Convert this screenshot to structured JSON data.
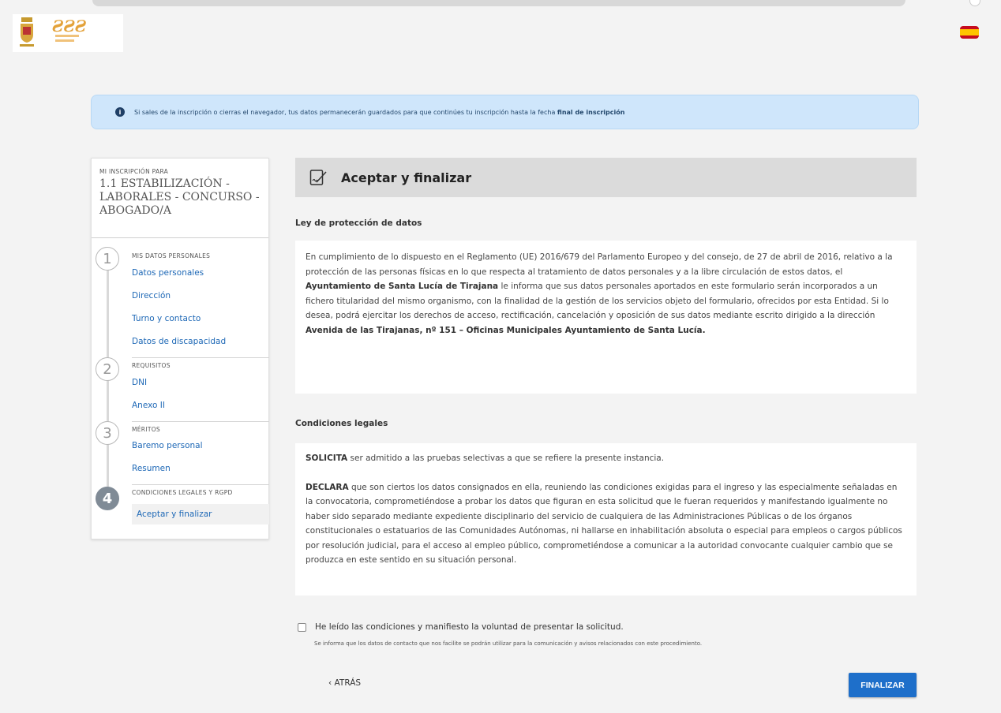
{
  "header": {
    "logo_name": "Santa Lucía",
    "language_flag": "es-flag"
  },
  "notice": {
    "text_before": "Si sales de la inscripción o cierras el navegador, tus datos permanecerán guardados para que continúes tu inscripción hasta la fecha",
    "text_bold": "final de inscripción"
  },
  "sidebar": {
    "caption": "MI INSCRIPCIÓN PARA",
    "title": "1.1 ESTABILIZACIÓN - LABORALES - CONCURSO - ABOGADO/A",
    "sections": [
      {
        "number": "1",
        "title": "MIS DATOS PERSONALES",
        "items": [
          "Datos personales",
          "Dirección",
          "Turno y contacto",
          "Datos de discapacidad"
        ]
      },
      {
        "number": "2",
        "title": "REQUISITOS",
        "items": [
          "DNI",
          "Anexo II"
        ]
      },
      {
        "number": "3",
        "title": "MÉRITOS",
        "items": [
          "Baremo personal",
          "Resumen"
        ]
      },
      {
        "number": "4",
        "title": "CONDICIONES LEGALES Y RGPD",
        "items": [
          "Aceptar y finalizar"
        ]
      }
    ]
  },
  "main": {
    "title": "Aceptar y finalizar",
    "section1_title": "Ley de protección de datos",
    "section1_p1_a": "En cumplimiento de lo dispuesto en el Reglamento (UE) 2016/679 del Parlamento Europeo y del consejo, de 27 de abril de 2016, relativo a la protección de las personas físicas en lo que respecta al tratamiento de datos personales y a la libre circulación de estos datos, el ",
    "section1_p1_b": "Ayuntamiento de Santa Lucía de Tirajana",
    "section1_p1_c": " le informa que sus datos personales aportados en este formulario serán incorporados a un fichero titularidad del mismo organismo, con la finalidad de la gestión de los servicios objeto del formulario, ofrecidos por esta Entidad. Si lo desea, podrá ejercitar los derechos de acceso, rectificación, cancelación y oposición de sus datos mediante escrito dirigido a la dirección ",
    "section1_p1_d": "Avenida de las Tirajanas, nº 151 – Oficinas Municipales Ayuntamiento de Santa Lucía.",
    "section2_title": "Condiciones legales",
    "solicita_b": "SOLICITA",
    "solicita_t": " ser admitido a las pruebas selectivas a que se refiere la presente instancia.",
    "declara_b": "DECLARA",
    "declara_t": " que son ciertos los datos consignados en ella, reuniendo las condiciones exigidas para el ingreso y las especialmente señaladas en la convocatoria, comprometiéndose a probar los datos que figuran en esta solicitud que le fueran requeridos y manifestando igualmente no haber sido separado mediante expediente disciplinario del servicio de cualquiera de las Administraciones Públicas o de los órganos constitucionales o estatuarios de las Comunidades Autónomas, ni hallarse en inhabilitación absoluta o especial para empleos o cargos públicos por resolución judicial, para el acceso al empleo público, comprometiéndose a comunicar a la autoridad convocante cualquier cambio que se produzca en este sentido en su situación personal.",
    "checkbox_label": "He leído las condiciones y manifiesto la voluntad de presentar la solicitud.",
    "note": "Se informa que los datos de contacto que nos facilite se podrán utilizar para la comunicación y avisos relacionados con este procedimiento.",
    "back_label": "ATRÁS",
    "finish_label": "FINALIZAR"
  }
}
